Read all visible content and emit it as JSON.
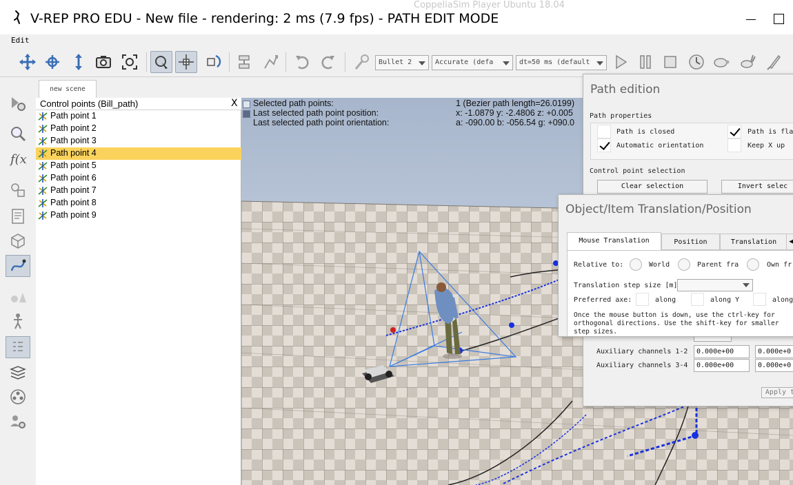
{
  "window": {
    "title": "V-REP PRO EDU - New file - rendering: 2 ms (7.9 fps) - PATH EDIT MODE",
    "background_text": "CoppeliaSim Player Ubuntu 18.04"
  },
  "menu": {
    "items": [
      "Edit"
    ]
  },
  "toolbar": {
    "engine": "Bullet 2",
    "accuracy": "Accurate (defa",
    "timestep": "dt=50 ms (default"
  },
  "scene_tab": "new scene",
  "hierarchy": {
    "header": "Control points (Bill_path)",
    "close": "X",
    "items": [
      "Path point 1",
      "Path point 2",
      "Path point 3",
      "Path point 4",
      "Path point 5",
      "Path point 6",
      "Path point 7",
      "Path point 8",
      "Path point 9"
    ],
    "selected_index": 3
  },
  "viewport_info": {
    "rows": [
      {
        "label": "Selected path points:",
        "value": "1 (Bezier path length=26.0199)"
      },
      {
        "label": "Last selected path point position:",
        "value": "x: -1.0879   y: -2.4806   z: +0.005"
      },
      {
        "label": "Last selected path point orientation:",
        "value": "a: -090.00   b: -056.54   g: +090.0"
      }
    ]
  },
  "path_edition": {
    "title": "Path edition",
    "section_properties": "Path properties",
    "path_is_closed": "Path is closed",
    "path_is_flat": "Path is fla",
    "automatic_orientation": "Automatic orientation",
    "keep_x_up": "Keep X up",
    "section_selection": "Control point selection",
    "clear_selection": "Clear selection",
    "invert_selection": "Invert selec",
    "aux12_label": "Auxiliary channels 1-2",
    "aux34_label": "Auxiliary channels 3-4",
    "aux_value": "0.000e+00",
    "aux_value_b": "0.000e+0",
    "apply": "Apply to"
  },
  "translation_dialog": {
    "title": "Object/Item Translation/Position",
    "tabs": [
      "Mouse Translation",
      "Position",
      "Translation"
    ],
    "relative_to": "Relative to:",
    "world": "World",
    "parent_frame": "Parent fra",
    "own_frame": "Own fr",
    "step_size": "Translation step size [m]",
    "preferred_axes": "Preferred axe:",
    "along": "along",
    "along_y": "along Y",
    "along_z": "along",
    "note_line1": "Once the mouse button is down, use the ctrl-key for",
    "note_line2": "orthogonal directions. Use the shift-key for smaller",
    "note_line3": "step sizes."
  },
  "colors": {
    "selected_row": "#fbd35c",
    "floor_light": "#e5e0d8",
    "floor_dark": "#a09a92",
    "sky_top": "#a7b6cc",
    "sky_bottom": "#dfe5ef",
    "path_blue": "#1830e0"
  }
}
